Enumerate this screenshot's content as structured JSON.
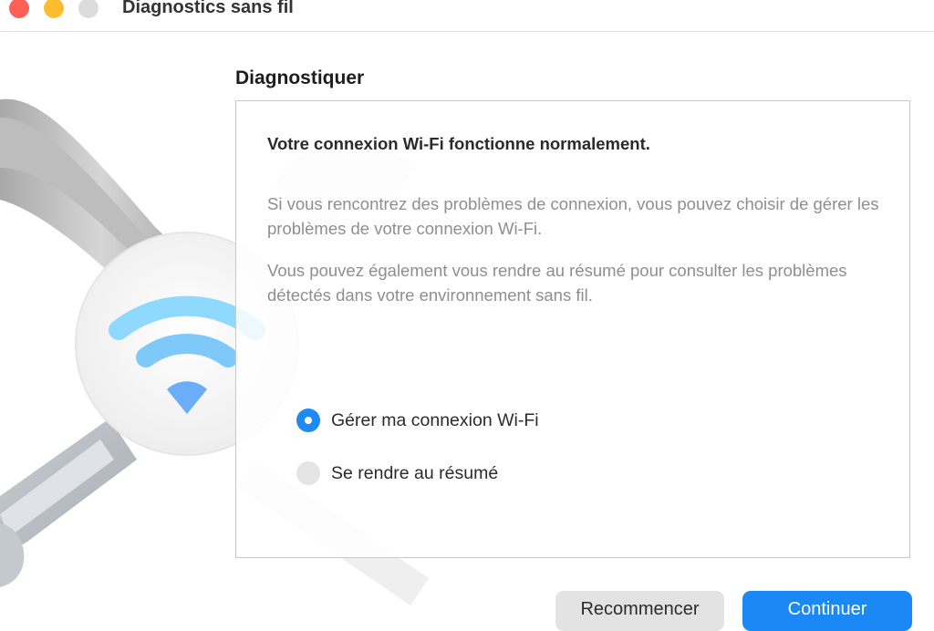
{
  "window": {
    "title": "Diagnostics sans fil",
    "controls": [
      "close",
      "minimize",
      "zoom"
    ]
  },
  "illustration": {
    "icons": [
      "wrench-icon",
      "wifi-icon"
    ],
    "colors": {
      "wifi_accent": "#8fd8ff"
    }
  },
  "section": {
    "title": "Diagnostiquer"
  },
  "panel": {
    "headline": "Votre connexion Wi-Fi fonctionne normalement.",
    "paragraphs": [
      "Si vous rencontrez des problèmes de connexion, vous pouvez choisir de gérer les problèmes de votre connexion Wi-Fi.",
      "Vous pouvez également vous rendre au résumé pour consulter les problèmes détectés dans votre environnement sans fil."
    ],
    "options": [
      {
        "label": "Gérer ma connexion Wi-Fi",
        "selected": true
      },
      {
        "label": "Se rendre au résumé",
        "selected": false
      }
    ]
  },
  "buttons": {
    "restart": "Recommencer",
    "continue": "Continuer"
  },
  "colors": {
    "accent": "#1a88f5",
    "close": "#fe5f57",
    "minimize": "#febc2e",
    "zoom_disabled": "#dcdcdc"
  }
}
